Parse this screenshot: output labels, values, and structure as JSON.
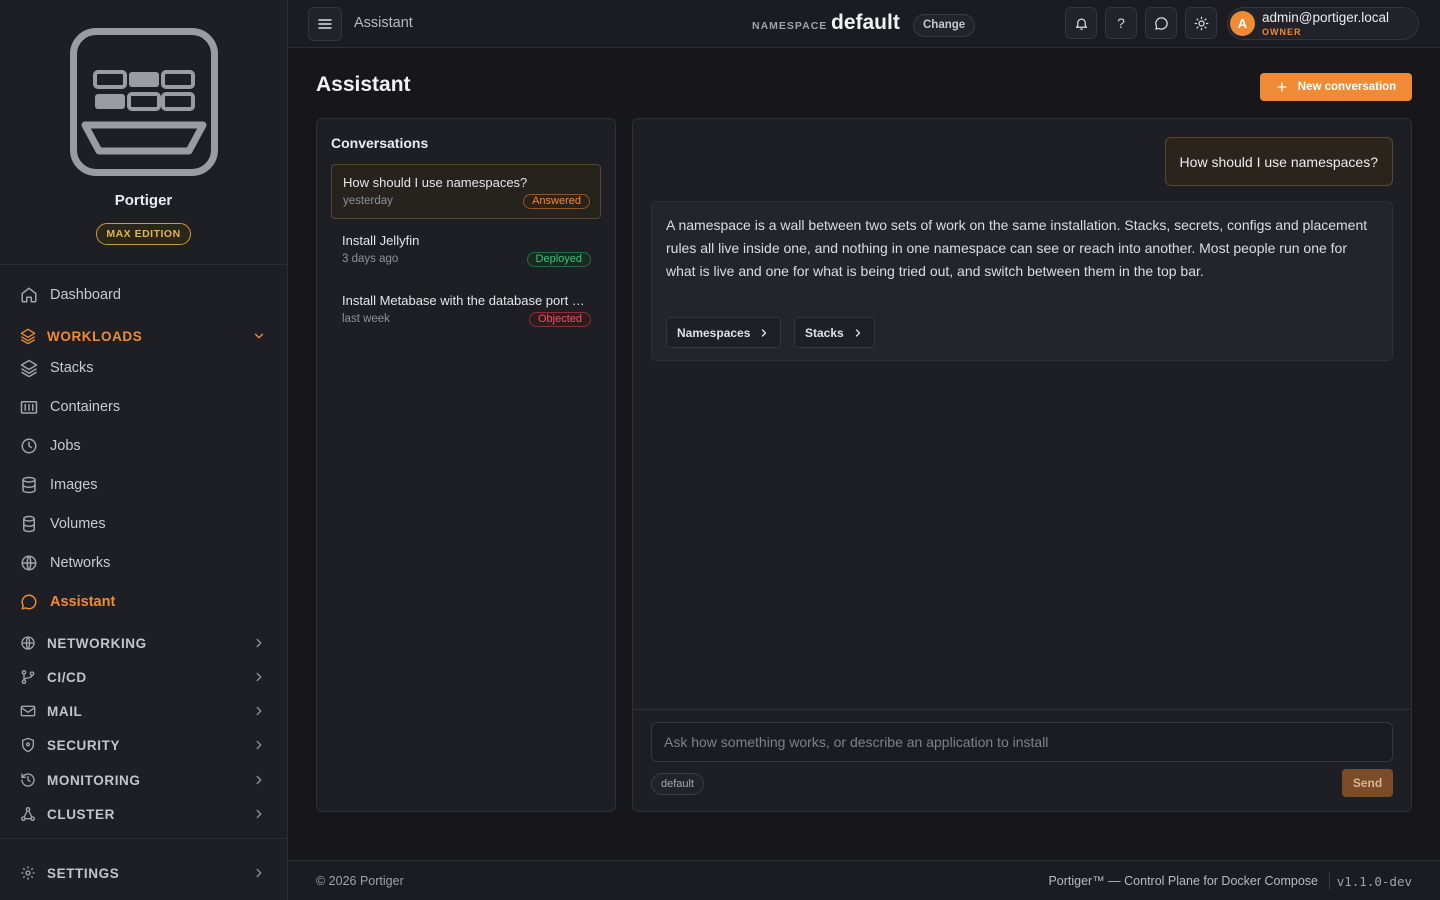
{
  "brand": {
    "name": "Portiger",
    "edition": "MAX EDITION"
  },
  "sidebar": {
    "items": [
      {
        "key": "dashboard",
        "label": "Dashboard"
      },
      {
        "key": "stacks",
        "label": "Stacks"
      },
      {
        "key": "containers",
        "label": "Containers"
      },
      {
        "key": "jobs",
        "label": "Jobs"
      },
      {
        "key": "images",
        "label": "Images"
      },
      {
        "key": "volumes",
        "label": "Volumes"
      },
      {
        "key": "networks",
        "label": "Networks"
      },
      {
        "key": "assistant",
        "label": "Assistant"
      }
    ],
    "groups": [
      {
        "key": "workloads",
        "label": "WORKLOADS"
      },
      {
        "key": "networking",
        "label": "NETWORKING"
      },
      {
        "key": "cicd",
        "label": "CI/CD"
      },
      {
        "key": "mail",
        "label": "MAIL"
      },
      {
        "key": "security",
        "label": "SECURITY"
      },
      {
        "key": "monitoring",
        "label": "MONITORING"
      },
      {
        "key": "cluster",
        "label": "CLUSTER"
      },
      {
        "key": "settings",
        "label": "SETTINGS"
      }
    ]
  },
  "topbar": {
    "title": "Assistant",
    "namespace_label": "NAMESPACE",
    "namespace_value": "default",
    "change_label": "Change",
    "help_glyph": "?",
    "user": {
      "initial": "A",
      "email": "admin@portiger.local",
      "role": "OWNER"
    }
  },
  "page": {
    "title": "Assistant",
    "new_button": "New conversation"
  },
  "conversations": {
    "heading": "Conversations",
    "items": [
      {
        "title": "How should I use namespaces?",
        "time": "yesterday",
        "status": "Answered"
      },
      {
        "title": "Install Jellyfin",
        "time": "3 days ago",
        "status": "Deployed"
      },
      {
        "title": "Install Metabase with the database port …",
        "time": "last week",
        "status": "Objected"
      }
    ]
  },
  "chat": {
    "user_message": "How should I use namespaces?",
    "assistant_message": "A namespace is a wall between two sets of work on the same installation. Stacks, secrets, configs and placement rules all live inside one, and nothing in one namespace can see or reach into another. Most people run one for what is live and one for what is being tried out, and switch between them in the top bar.",
    "chips": [
      "Namespaces",
      "Stacks"
    ],
    "composer_placeholder": "Ask how something works, or describe an application to install",
    "namespace_pill": "default",
    "send_label": "Send"
  },
  "footer": {
    "copyright": "© 2026 Portiger",
    "tagline": "Portiger™ — Control Plane for Docker Compose",
    "version": "v1.1.0-dev"
  },
  "colors": {
    "accent": "#ef8b35",
    "success": "#34c779",
    "danger": "#f0535d",
    "edition": "#e0b25a"
  }
}
